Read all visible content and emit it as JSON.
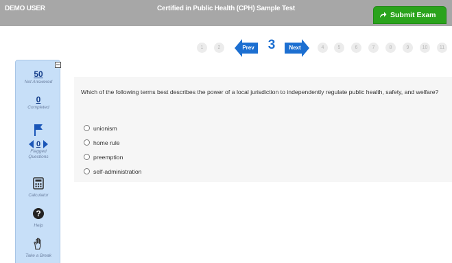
{
  "header": {
    "user": "DEMO USER",
    "title": "Certified in Public Health (CPH) Sample Test",
    "submit_label": "Submit Exam"
  },
  "pagination": {
    "pages_before": [
      "1",
      "2"
    ],
    "prev_label": "Prev",
    "current": "3",
    "next_label": "Next",
    "pages_after": [
      "4",
      "5",
      "6",
      "7",
      "8",
      "9",
      "10",
      "11"
    ]
  },
  "sidebar": {
    "not_answered_count": "50",
    "not_answered_label": "Not Answered",
    "completed_count": "0",
    "completed_label": "Completed",
    "flagged_count": "0",
    "flagged_label_1": "Flagged",
    "flagged_label_2": "Questions",
    "calculator_label": "Calculator",
    "help_label": "Help",
    "break_label": "Take a Break"
  },
  "question": {
    "text": "Which of the following terms best describes the power of a local jurisdiction to independently regulate public health, safety, and welfare?",
    "options": [
      "unionism",
      "home rule",
      "preemption",
      "self-administration"
    ]
  },
  "colors": {
    "header_bg": "#a7a7a7",
    "submit_green": "#2aa31c",
    "nav_blue": "#1c6fd1",
    "sidebar_bg": "#c7dff8"
  }
}
